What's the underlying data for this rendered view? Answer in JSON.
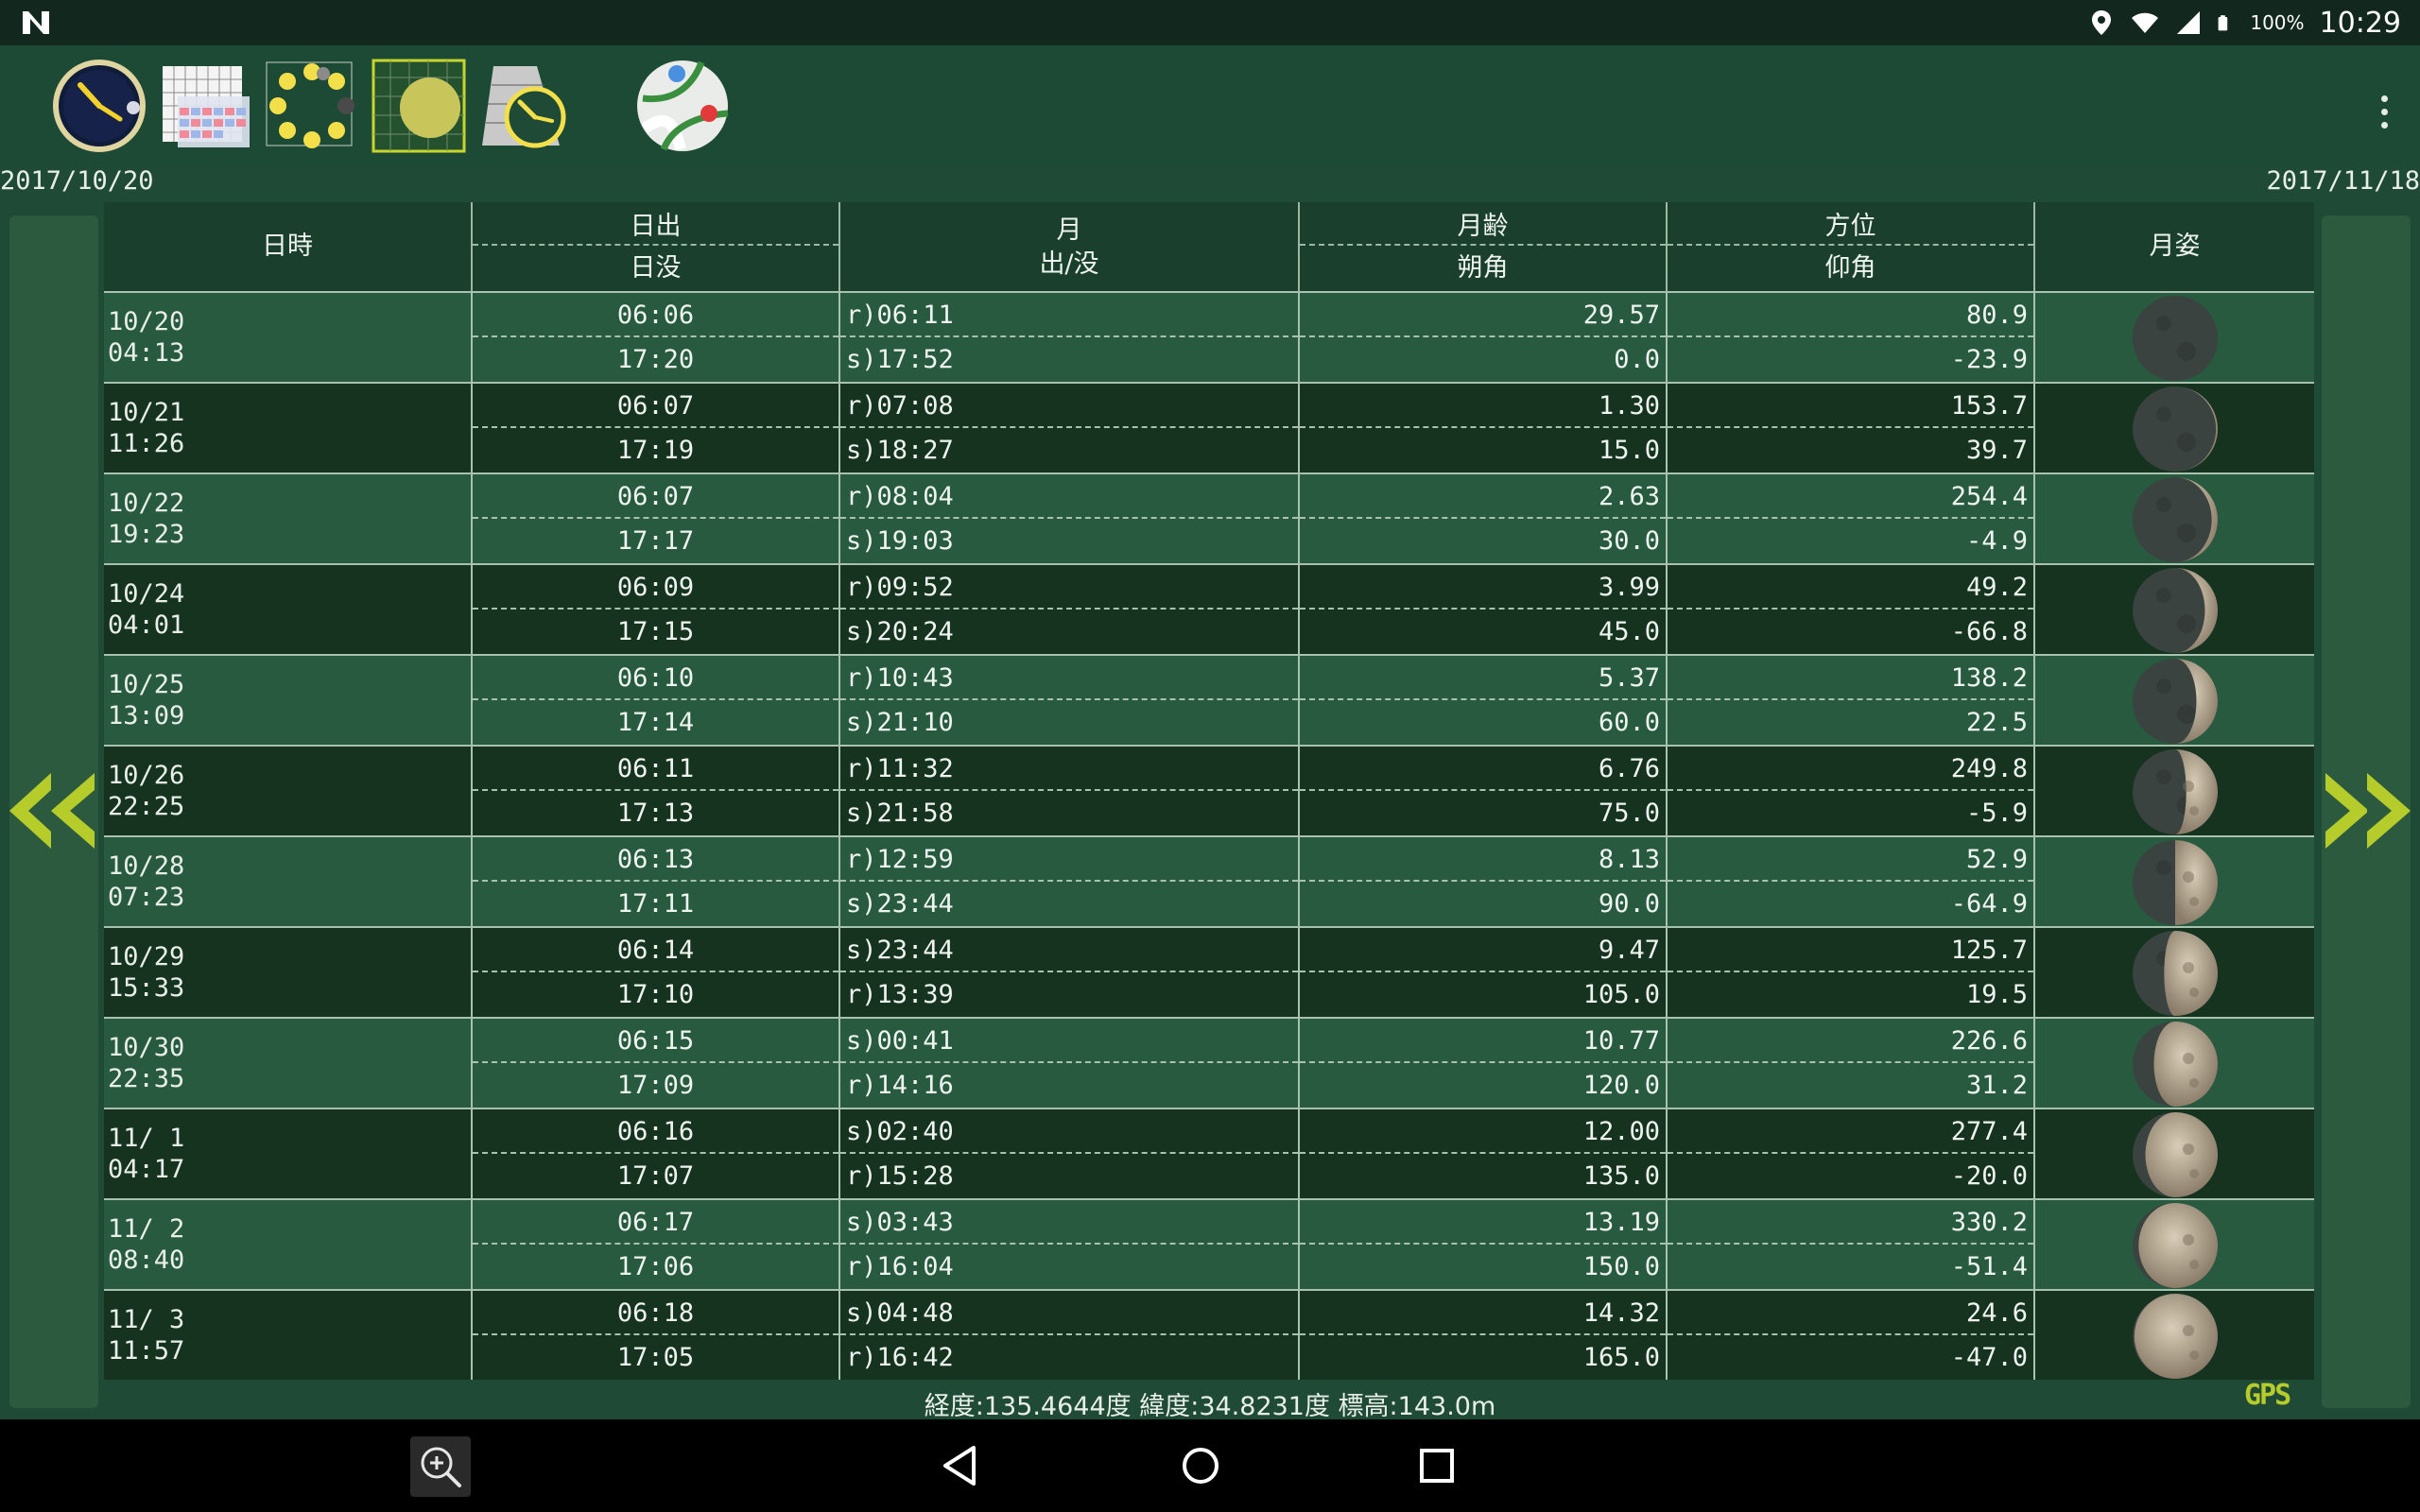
{
  "status": {
    "battery": "100%",
    "time": "10:29"
  },
  "dates": {
    "start": "2017/10/20",
    "end": "2017/11/18"
  },
  "headers": {
    "datetime": "日時",
    "sunrise": "日出",
    "sunset": "日没",
    "moon": "月",
    "moon_rise_set": "出/没",
    "moon_age": "月齢",
    "phase_angle": "朔角",
    "azimuth": "方位",
    "elevation": "仰角",
    "moon_shape": "月姿"
  },
  "rows": [
    {
      "date": "10/20",
      "time": "04:13",
      "sunrise": "06:06",
      "sunset": "17:20",
      "moon1": "r)06:11",
      "moon2": "s)17:52",
      "age": "29.57",
      "angle": "0.0",
      "azimuth": "80.9",
      "elevation": "-23.9",
      "illum": 0.0
    },
    {
      "date": "10/21",
      "time": "11:26",
      "sunrise": "06:07",
      "sunset": "17:19",
      "moon1": "r)07:08",
      "moon2": "s)18:27",
      "age": "1.30",
      "angle": "15.0",
      "azimuth": "153.7",
      "elevation": "39.7",
      "illum": 0.02
    },
    {
      "date": "10/22",
      "time": "19:23",
      "sunrise": "06:07",
      "sunset": "17:17",
      "moon1": "r)08:04",
      "moon2": "s)19:03",
      "age": "2.63",
      "angle": "30.0",
      "azimuth": "254.4",
      "elevation": "-4.9",
      "illum": 0.07
    },
    {
      "date": "10/24",
      "time": "04:01",
      "sunrise": "06:09",
      "sunset": "17:15",
      "moon1": "r)09:52",
      "moon2": "s)20:24",
      "age": "3.99",
      "angle": "45.0",
      "azimuth": "49.2",
      "elevation": "-66.8",
      "illum": 0.15
    },
    {
      "date": "10/25",
      "time": "13:09",
      "sunrise": "06:10",
      "sunset": "17:14",
      "moon1": "r)10:43",
      "moon2": "s)21:10",
      "age": "5.37",
      "angle": "60.0",
      "azimuth": "138.2",
      "elevation": "22.5",
      "illum": 0.25
    },
    {
      "date": "10/26",
      "time": "22:25",
      "sunrise": "06:11",
      "sunset": "17:13",
      "moon1": "r)11:32",
      "moon2": "s)21:58",
      "age": "6.76",
      "angle": "75.0",
      "azimuth": "249.8",
      "elevation": "-5.9",
      "illum": 0.37
    },
    {
      "date": "10/28",
      "time": "07:23",
      "sunrise": "06:13",
      "sunset": "17:11",
      "moon1": "r)12:59",
      "moon2": "s)23:44",
      "age": "8.13",
      "angle": "90.0",
      "azimuth": "52.9",
      "elevation": "-64.9",
      "illum": 0.5
    },
    {
      "date": "10/29",
      "time": "15:33",
      "sunrise": "06:14",
      "sunset": "17:10",
      "moon1": "s)23:44",
      "moon2": "r)13:39",
      "age": "9.47",
      "angle": "105.0",
      "azimuth": "125.7",
      "elevation": "19.5",
      "illum": 0.63
    },
    {
      "date": "10/30",
      "time": "22:35",
      "sunrise": "06:15",
      "sunset": "17:09",
      "moon1": "s)00:41",
      "moon2": "r)14:16",
      "age": "10.77",
      "angle": "120.0",
      "azimuth": "226.6",
      "elevation": "31.2",
      "illum": 0.75
    },
    {
      "date": "11/ 1",
      "time": "04:17",
      "sunrise": "06:16",
      "sunset": "17:07",
      "moon1": "s)02:40",
      "moon2": "r)15:28",
      "age": "12.00",
      "angle": "135.0",
      "azimuth": "277.4",
      "elevation": "-20.0",
      "illum": 0.85
    },
    {
      "date": "11/ 2",
      "time": "08:40",
      "sunrise": "06:17",
      "sunset": "17:06",
      "moon1": "s)03:43",
      "moon2": "r)16:04",
      "age": "13.19",
      "angle": "150.0",
      "azimuth": "330.2",
      "elevation": "-51.4",
      "illum": 0.93
    },
    {
      "date": "11/ 3",
      "time": "11:57",
      "sunrise": "06:18",
      "sunset": "17:05",
      "moon1": "s)04:48",
      "moon2": "r)16:42",
      "age": "14.32",
      "angle": "165.0",
      "azimuth": "24.6",
      "elevation": "-47.0",
      "illum": 0.98
    }
  ],
  "footer": {
    "coords": "経度:135.4644度 緯度:34.8231度 標高:143.0m",
    "gps": "GPS"
  },
  "colors": {
    "accent": "#b6cc2a",
    "background": "#1f4a35",
    "row_light": "#275a3e",
    "row_dark": "#15331f"
  }
}
